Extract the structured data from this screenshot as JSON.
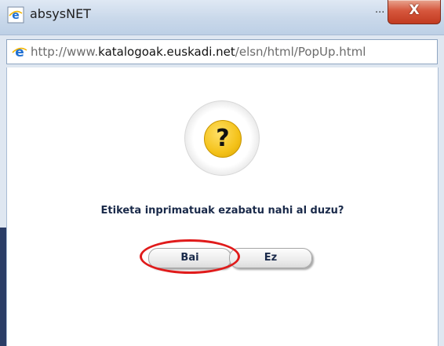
{
  "window": {
    "title": "absysNET",
    "title_overflow": "...",
    "close_label": "X"
  },
  "address_bar": {
    "url_prefix": "http://www.",
    "url_domain": "katalogoak.euskadi.net",
    "url_path": "/elsn/html/PopUp.html"
  },
  "dialog": {
    "icon_glyph": "?",
    "message": "Etiketa inprimatuak ezabatu nahi al duzu?",
    "yes_label": "Bai",
    "no_label": "Ez"
  },
  "colors": {
    "highlight": "#e01b1b",
    "badge": "#f4c21a",
    "text": "#1a2a4a"
  }
}
